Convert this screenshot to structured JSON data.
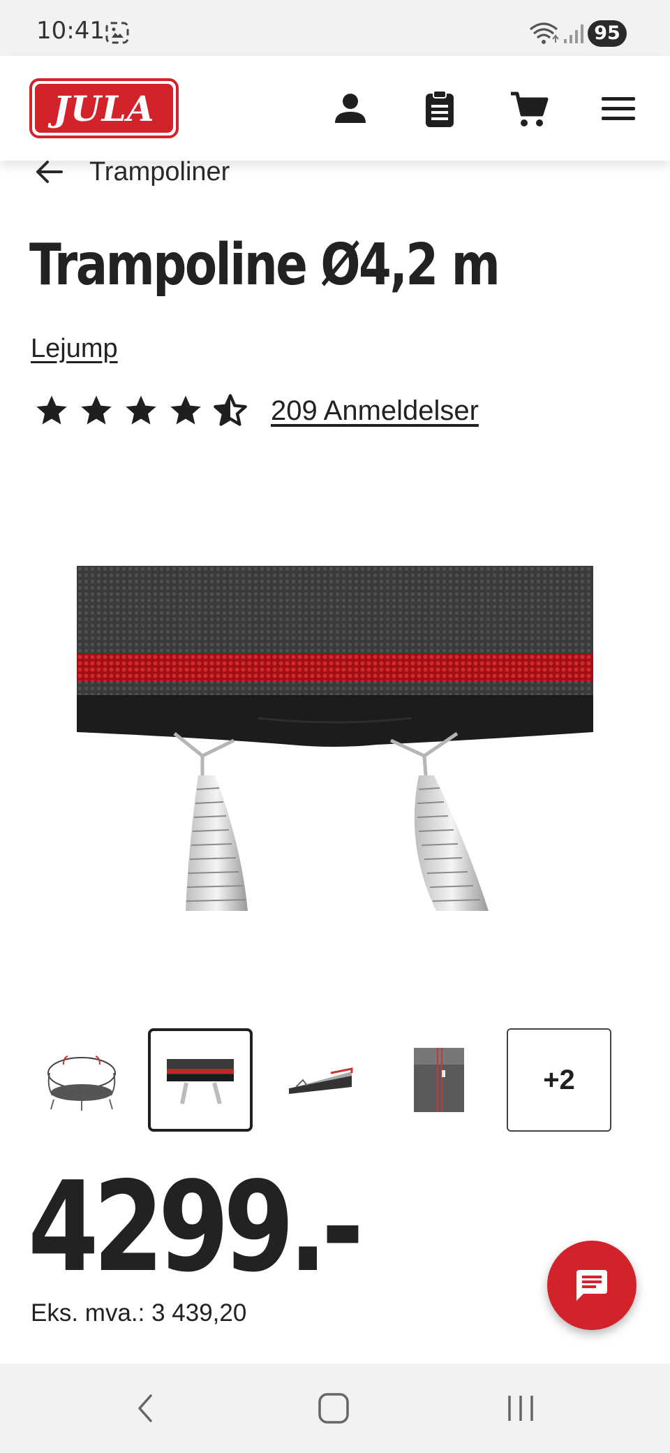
{
  "status_bar": {
    "time": "10:41",
    "battery": "95",
    "icons": [
      "screenshot-icon",
      "wifi-icon",
      "signal-icon"
    ]
  },
  "header": {
    "logo_text": "JULA",
    "brand_color": "#d2232a",
    "icons": [
      "account-icon",
      "clipboard-icon",
      "cart-icon",
      "menu-icon"
    ]
  },
  "breadcrumb": {
    "label": "Trampoliner"
  },
  "product": {
    "title": "Trampoline Ø4,2 m",
    "brand": "Lejump",
    "rating": 4.5,
    "rating_max": 5,
    "reviews_label": "209 Anmeldelser",
    "price": "4299.-",
    "vat_label": "Eks. mva.: 3 439,20"
  },
  "gallery": {
    "selected_index": 1,
    "thumbnails": [
      "trampoline-overview",
      "net-and-springs",
      "frame-pad-detail",
      "net-door-detail"
    ],
    "more_label": "+2"
  },
  "nav_bar": {
    "icons": [
      "back-icon",
      "home-icon",
      "recents-icon"
    ]
  }
}
